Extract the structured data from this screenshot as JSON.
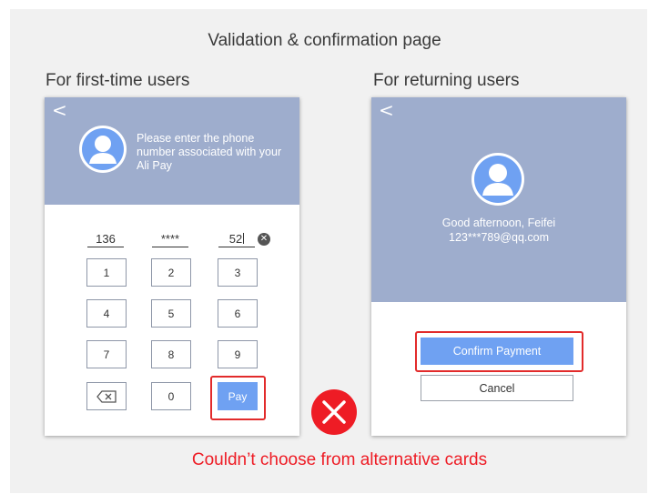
{
  "title": "Validation & confirmation page",
  "first_time": {
    "label": "For first-time users",
    "back_glyph": "<",
    "prompt": "Please enter the phone number associated with your Ali Pay",
    "phone": {
      "prefix": "136",
      "middle": "****",
      "suffix": "52"
    },
    "keys": [
      "1",
      "2",
      "3",
      "4",
      "5",
      "6",
      "7",
      "8",
      "9",
      "0"
    ],
    "pay_label": "Pay"
  },
  "returning": {
    "label": "For returning users",
    "back_glyph": "<",
    "greeting": "Good afternoon, Feifei",
    "email": "123***789@qq.com",
    "confirm_label": "Confirm Payment",
    "cancel_label": "Cancel"
  },
  "caption": "Couldn’t choose from alternative cards",
  "colors": {
    "header": "#9eadcd",
    "button_blue": "#6fa1f2",
    "highlight_red": "#e22b2b",
    "error_red": "#ee1c25"
  },
  "icons": [
    "back-arrow-icon",
    "avatar-icon",
    "clear-icon",
    "backspace-icon",
    "error-x-icon"
  ]
}
